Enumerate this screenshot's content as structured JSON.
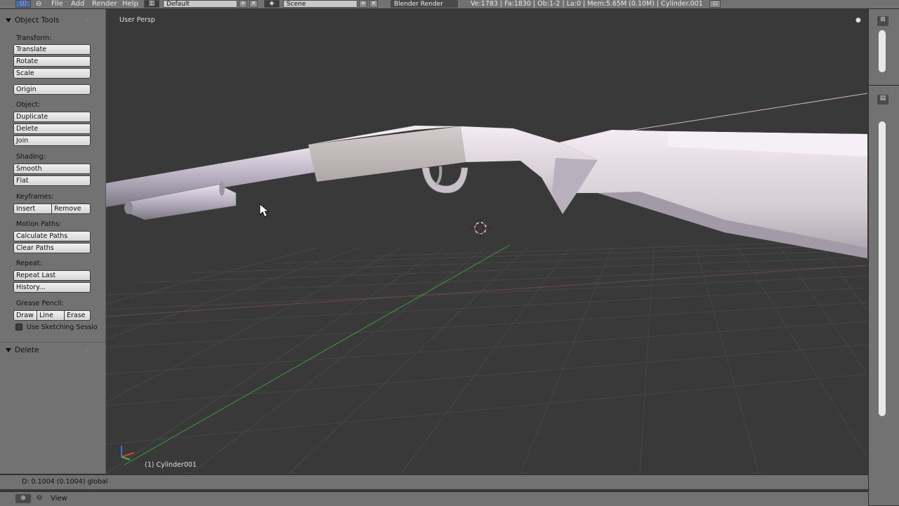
{
  "menu": {
    "file": "File",
    "add": "Add",
    "render": "Render",
    "help": "Help"
  },
  "topbar": {
    "screen_layout": "Default",
    "scene": "Scene",
    "render_engine": "Blender Render",
    "stats": "Ve:1783 | Fa:1830 | Ob:1-2 | La:0 | Mem:5.65M (0.10M) | Cylinder.001"
  },
  "tool_shelf": {
    "panel_title": "Object Tools",
    "transform_label": "Transform:",
    "translate": "Translate",
    "rotate": "Rotate",
    "scale": "Scale",
    "origin": "Origin",
    "object_label": "Object:",
    "duplicate": "Duplicate",
    "delete": "Delete",
    "join": "Join",
    "shading_label": "Shading:",
    "smooth": "Smooth",
    "flat": "Flat",
    "keyframes_label": "Keyframes:",
    "insert": "Insert",
    "remove": "Remove",
    "motion_paths_label": "Motion Paths:",
    "calculate_paths": "Calculate Paths",
    "clear_paths": "Clear Paths",
    "repeat_label": "Repeat:",
    "repeat_last": "Repeat Last",
    "history": "History...",
    "grease_pencil_label": "Grease Pencil:",
    "draw": "Draw",
    "line": "Line",
    "erase": "Erase",
    "use_sketching": "Use Sketching Sessio",
    "delete_panel_title": "Delete"
  },
  "viewport": {
    "view_name": "User Persp",
    "object_info": "(1) Cylinder001"
  },
  "status": {
    "operator_info": "D: 0.1004 (0.1004) global"
  },
  "bottom": {
    "view": "View"
  },
  "colors": {
    "panel_bg": "#727272",
    "viewport_bg": "#393939",
    "grid_line": "#474747",
    "x_axis": "#7a4a4a",
    "y_axis": "#3f9a3f",
    "model": "#d8d0d8"
  },
  "icons": [
    "info-icon",
    "screen-layout-icon",
    "scene-icon",
    "add-icon",
    "close-icon",
    "toggle-icon",
    "cursor-icon",
    "crosshair-icon"
  ]
}
